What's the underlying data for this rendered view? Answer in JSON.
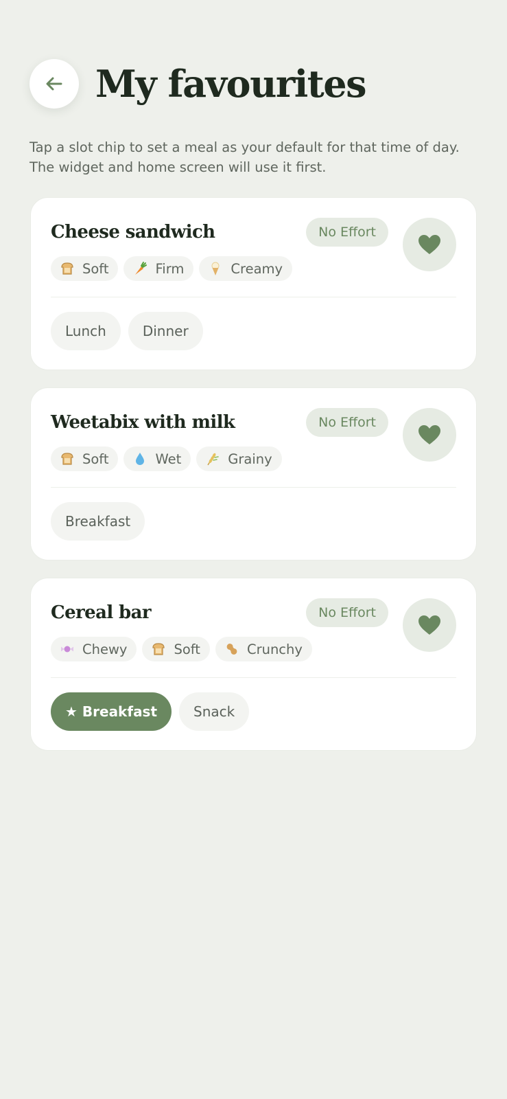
{
  "header": {
    "back_icon": "arrow-left-icon",
    "title": "My favourites"
  },
  "subtitle": {
    "line1": "Tap a slot chip to set a meal as your default for that time of day.",
    "line2": "The widget and home screen will use it first."
  },
  "colors": {
    "background": "#eef0eb",
    "accent": "#6a8860",
    "badge_bg": "#e6ebe3",
    "chip_bg": "#f3f4f1"
  },
  "favourites": [
    {
      "name": "Cheese sandwich",
      "effort": "No Effort",
      "favourite_icon": "heart-icon",
      "textures": [
        {
          "icon": "bread-icon",
          "label": "Soft"
        },
        {
          "icon": "carrot-icon",
          "label": "Firm"
        },
        {
          "icon": "ice-cream-icon",
          "label": "Creamy"
        }
      ],
      "slots": [
        {
          "label": "Lunch",
          "selected": false
        },
        {
          "label": "Dinner",
          "selected": false
        }
      ]
    },
    {
      "name": "Weetabix with milk",
      "effort": "No Effort",
      "favourite_icon": "heart-icon",
      "textures": [
        {
          "icon": "bread-icon",
          "label": "Soft"
        },
        {
          "icon": "droplet-icon",
          "label": "Wet"
        },
        {
          "icon": "wheat-icon",
          "label": "Grainy"
        }
      ],
      "slots": [
        {
          "label": "Breakfast",
          "selected": false
        }
      ]
    },
    {
      "name": "Cereal bar",
      "effort": "No Effort",
      "favourite_icon": "heart-icon",
      "textures": [
        {
          "icon": "candy-icon",
          "label": "Chewy"
        },
        {
          "icon": "bread-icon",
          "label": "Soft"
        },
        {
          "icon": "peanut-icon",
          "label": "Crunchy"
        }
      ],
      "slots": [
        {
          "label": "★ Breakfast",
          "selected": true
        },
        {
          "label": "Snack",
          "selected": false
        }
      ]
    }
  ]
}
